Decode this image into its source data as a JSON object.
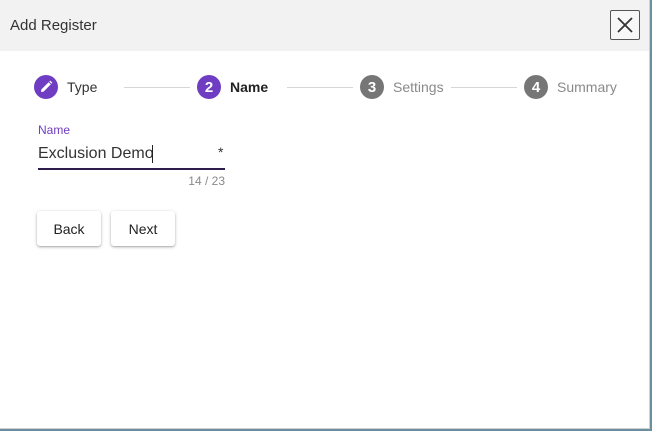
{
  "dialog": {
    "title": "Add Register",
    "close_icon": "close-icon"
  },
  "stepper": {
    "steps": [
      {
        "number": "",
        "label": "Type",
        "state": "completed",
        "icon": "pencil-edit-icon"
      },
      {
        "number": "2",
        "label": "Name",
        "state": "current"
      },
      {
        "number": "3",
        "label": "Settings",
        "state": "pending"
      },
      {
        "number": "4",
        "label": "Summary",
        "state": "pending"
      }
    ]
  },
  "form": {
    "name_field": {
      "label": "Name",
      "value": "Exclusion Demo",
      "required_marker": "*",
      "counter": "14 / 23",
      "current_length": 14,
      "max_length": 23
    }
  },
  "actions": {
    "back_label": "Back",
    "next_label": "Next"
  },
  "colors": {
    "accent": "#6f3dc2",
    "inactive_step": "#767676",
    "header_bg": "#f2f2f2"
  }
}
